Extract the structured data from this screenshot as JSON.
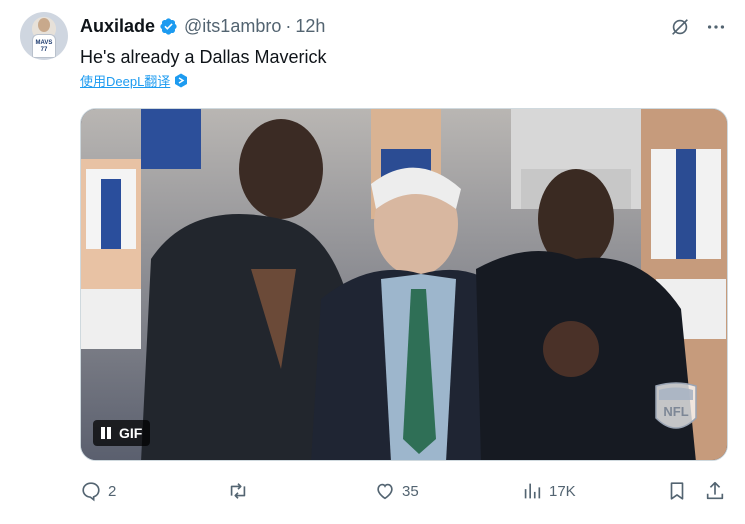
{
  "tweet": {
    "author_name": "Auxilade",
    "handle": "@its1ambro",
    "separator": "·",
    "time": "12h",
    "text": "He's already a Dallas Maverick",
    "translate_link": "使用DeepL翻译",
    "avatar_jersey_text": "MAVS 77"
  },
  "media": {
    "type": "gif",
    "badge_label": "GIF",
    "watermark": "NFL"
  },
  "actions": {
    "reply_count": "2",
    "retweet_count": "",
    "like_count": "35",
    "views_count": "17K"
  },
  "colors": {
    "verified": "#1d9bf0",
    "link": "#1d9bf0",
    "muted": "#536471",
    "text": "#0f1419"
  },
  "icons": [
    "verified-badge-icon",
    "grok-icon",
    "more-icon",
    "deepl-icon",
    "pause-icon",
    "reply-icon",
    "retweet-icon",
    "like-icon",
    "views-icon",
    "bookmark-icon",
    "share-icon"
  ]
}
